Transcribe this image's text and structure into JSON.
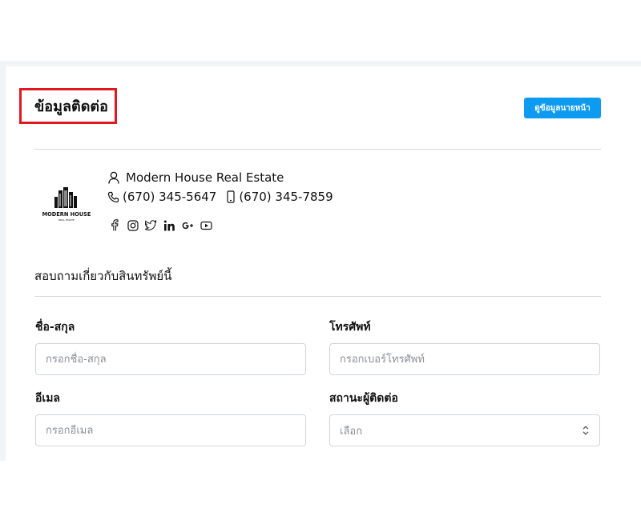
{
  "contact": {
    "title": "ข้อมูลติดต่อ",
    "agent_button": "ดูข้อมูลนายหน้า"
  },
  "agent": {
    "logo_text": "MODERN HOUSE",
    "logo_subtext": "REAL ESTATE",
    "name": "Modern House Real Estate",
    "phone": "(670) 345-5647",
    "mobile": "(670) 345-7859",
    "social_icons": [
      "facebook-icon",
      "instagram-icon",
      "twitter-icon",
      "linkedin-icon",
      "google-plus-icon",
      "youtube-icon"
    ]
  },
  "inquiry": {
    "title": "สอบถามเกี่ยวกับสินทรัพย์นี้",
    "name_label": "ชื่อ-สกุล",
    "name_placeholder": "กรอกชื่อ-สกุล",
    "phone_label": "โทรศัพท์",
    "phone_placeholder": "กรอกเบอร์โทรศัพท์",
    "email_label": "อีเมล",
    "email_placeholder": "กรอกอีเมล",
    "status_label": "สถานะผู้ติดต่อ",
    "status_value": "เลือก"
  },
  "colors": {
    "accent": "#0d9bf2",
    "highlight": "#e0191f"
  }
}
